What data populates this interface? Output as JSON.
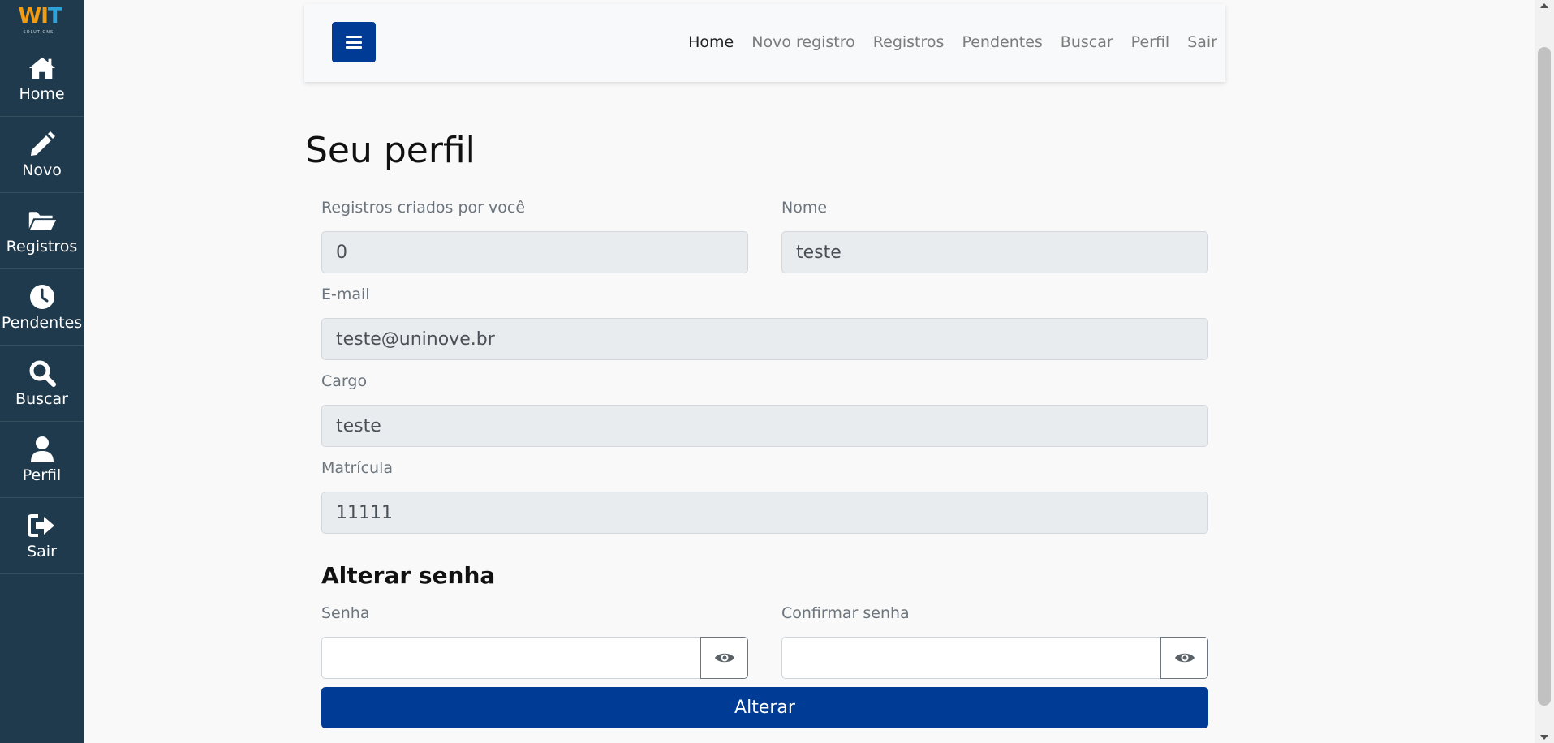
{
  "logo": {
    "mark_left": "W",
    "mark_i": "I",
    "mark_right": "T",
    "tagline": "SOLUTIONS"
  },
  "sidebar": {
    "items": [
      {
        "label": "Home",
        "icon": "home-icon"
      },
      {
        "label": "Novo",
        "icon": "pencil-icon"
      },
      {
        "label": "Registros",
        "icon": "folder-open-icon"
      },
      {
        "label": "Pendentes",
        "icon": "clock-icon"
      },
      {
        "label": "Buscar",
        "icon": "search-icon"
      },
      {
        "label": "Perfil",
        "icon": "user-icon"
      },
      {
        "label": "Sair",
        "icon": "sign-out-icon"
      }
    ]
  },
  "navbar": {
    "menu_icon": "hamburger-icon",
    "links": [
      {
        "label": "Home",
        "active": true
      },
      {
        "label": "Novo registro",
        "active": false
      },
      {
        "label": "Registros",
        "active": false
      },
      {
        "label": "Pendentes",
        "active": false
      },
      {
        "label": "Buscar",
        "active": false
      },
      {
        "label": "Perfil",
        "active": false
      },
      {
        "label": "Sair",
        "active": false
      }
    ]
  },
  "profile": {
    "title": "Seu perfil",
    "records_label": "Registros criados por você",
    "records_value": "0",
    "name_label": "Nome",
    "name_value": "teste",
    "email_label": "E-mail",
    "email_value": "teste@uninove.br",
    "role_label": "Cargo",
    "role_value": "teste",
    "id_label": "Matrícula",
    "id_value": "11111"
  },
  "password": {
    "section_title": "Alterar senha",
    "password_label": "Senha",
    "password_value": "",
    "confirm_label": "Confirmar senha",
    "confirm_value": "",
    "toggle_icon": "eye-icon",
    "submit_label": "Alterar"
  },
  "colors": {
    "sidebar_bg": "#1f3a4d",
    "primary": "#003b95",
    "page_bg": "#f9f9f9",
    "field_bg": "#e9ecef"
  }
}
